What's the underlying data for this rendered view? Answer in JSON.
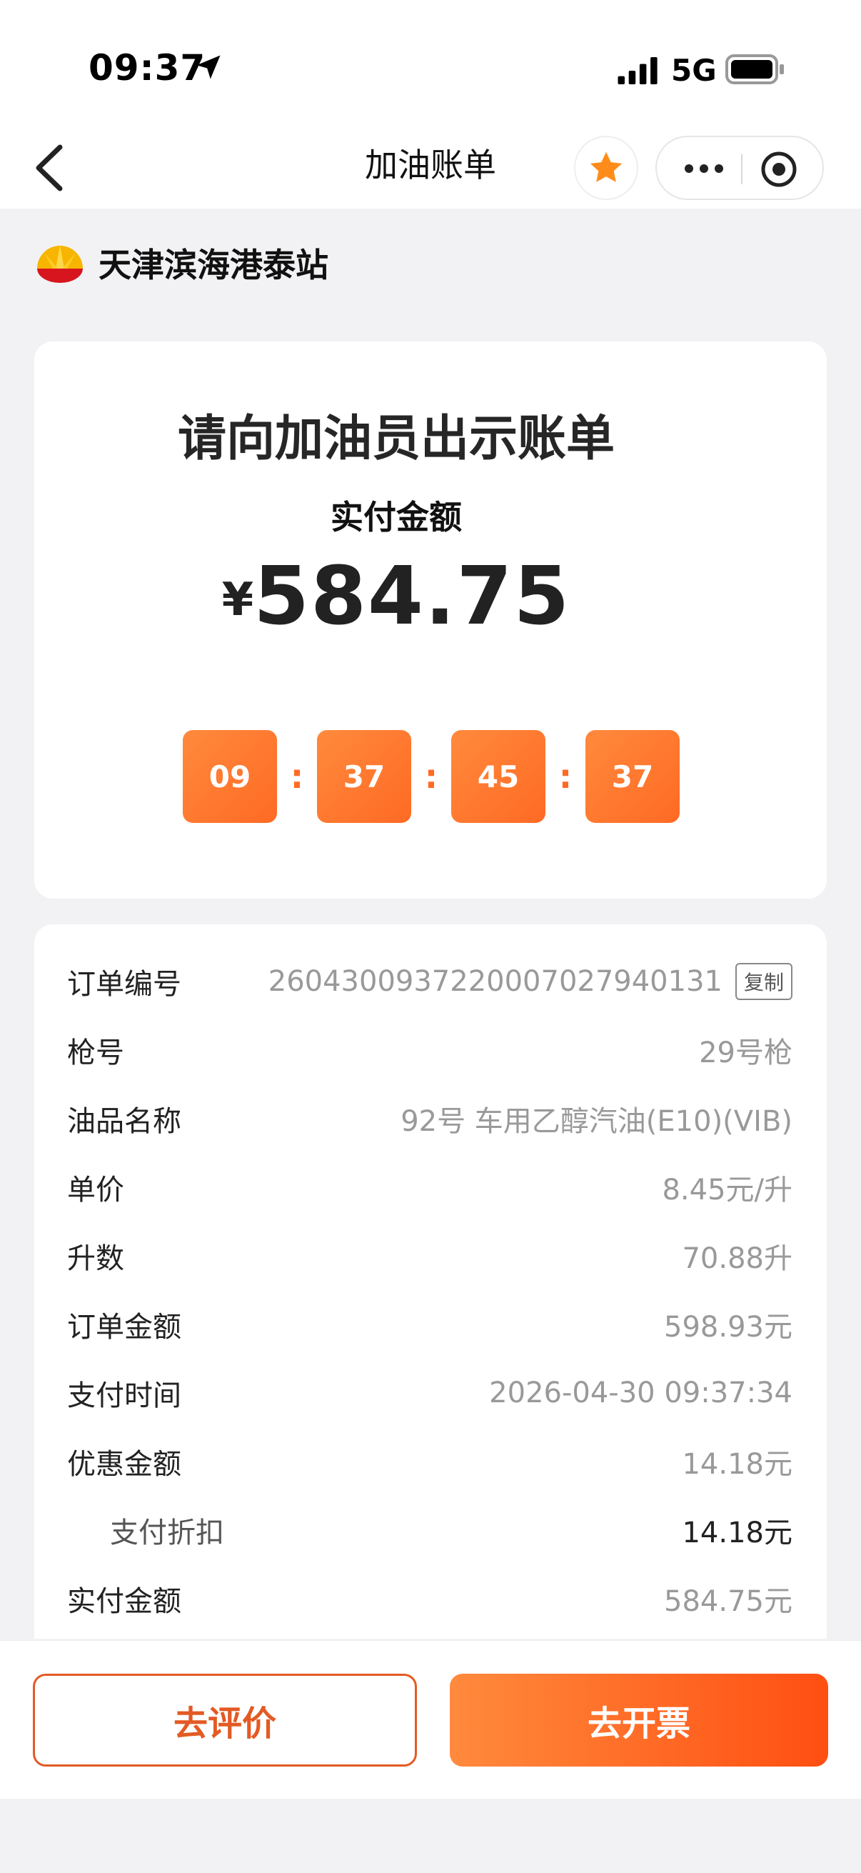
{
  "status_bar": {
    "time": "09:37",
    "network": "5G"
  },
  "nav": {
    "title": "加油账单"
  },
  "station": {
    "name": "天津滨海港泰站"
  },
  "bill": {
    "title": "请向加油员出示账单",
    "amount_label": "实付金额",
    "currency": "¥",
    "amount": "584.75",
    "timer": [
      "09",
      "37",
      "45",
      "37"
    ],
    "timer_sep": ":"
  },
  "details": {
    "copy_label": "复制",
    "rows": [
      {
        "label": "订单编号",
        "value": "2604300937220007027940131"
      },
      {
        "label": "枪号",
        "value": "29号枪"
      },
      {
        "label": "油品名称",
        "value": "92号 车用乙醇汽油(E10)(VIB)"
      },
      {
        "label": "单价",
        "value": "8.45元/升"
      },
      {
        "label": "升数",
        "value": "70.88升"
      },
      {
        "label": "订单金额",
        "value": "598.93元"
      },
      {
        "label": "支付时间",
        "value": "2026-04-30 09:37:34"
      },
      {
        "label": "优惠金额",
        "value": "14.18元"
      },
      {
        "label": "支付折扣",
        "value": "14.18元"
      },
      {
        "label": "实付金额",
        "value": "584.75元"
      }
    ]
  },
  "actions": {
    "rate": "去评价",
    "invoice": "去开票"
  },
  "colors": {
    "accent": "#ff6a23",
    "accent_dark": "#e35a24",
    "background": "#f2f2f4"
  }
}
